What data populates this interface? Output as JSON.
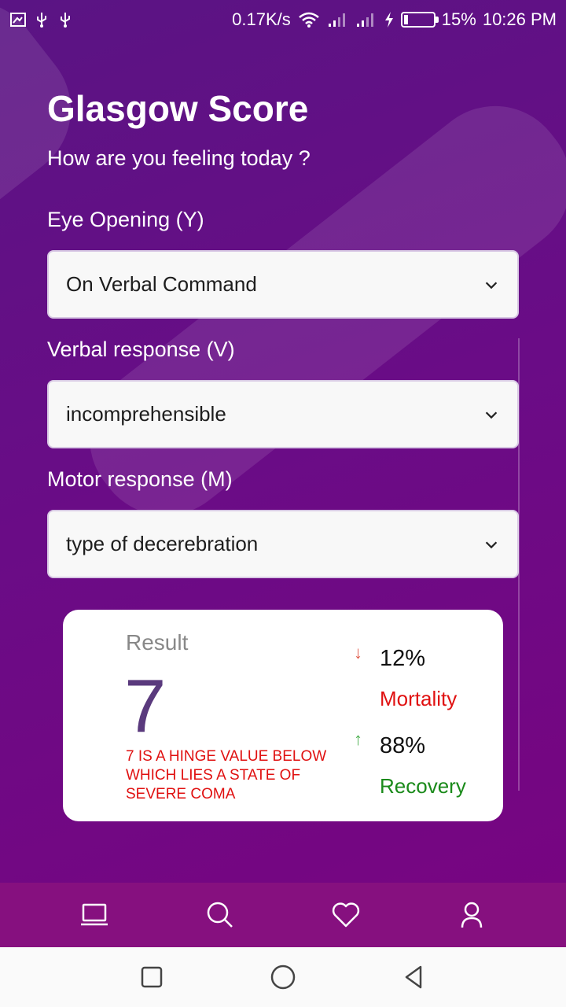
{
  "status_bar": {
    "net_speed": "0.17K/s",
    "battery": "15%",
    "battery_level": 0.15,
    "time": "10:26 PM"
  },
  "header": {
    "title": "Glasgow Score",
    "subtitle": "How are you feeling today ?"
  },
  "form": {
    "eye": {
      "label": "Eye Opening (Y)",
      "value": "On Verbal Command"
    },
    "verbal": {
      "label": "Verbal response (V)",
      "value": "incomprehensible"
    },
    "motor": {
      "label": "Motor response (M)",
      "value": "type of decerebration"
    }
  },
  "result": {
    "label": "Result",
    "value": "7",
    "note": "7 is a hinge value below which lies a state of severe coma",
    "mortality": {
      "percent": "12%",
      "label": "Mortality",
      "arrow": "↓",
      "color": "#e01010",
      "arrow_color": "#e05a4a"
    },
    "recovery": {
      "percent": "88%",
      "label": "Recovery",
      "arrow": "↑",
      "color": "#1a8a1a",
      "arrow_color": "#4caf50"
    }
  },
  "bottom_nav": {
    "items": [
      {
        "icon": "laptop-icon"
      },
      {
        "icon": "search-icon"
      },
      {
        "icon": "heart-icon"
      },
      {
        "icon": "user-icon"
      }
    ]
  },
  "system_nav": {
    "items": [
      {
        "icon": "square-icon"
      },
      {
        "icon": "circle-icon"
      },
      {
        "icon": "triangle-back-icon"
      }
    ]
  }
}
